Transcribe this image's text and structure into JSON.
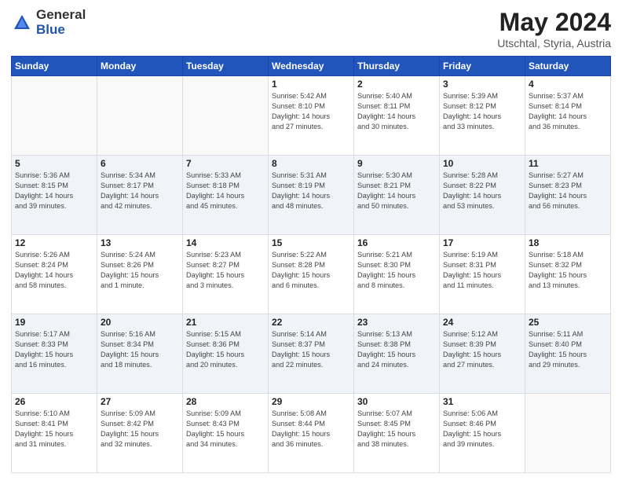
{
  "logo": {
    "general": "General",
    "blue": "Blue"
  },
  "title": {
    "month_year": "May 2024",
    "location": "Utschtal, Styria, Austria"
  },
  "weekdays": [
    "Sunday",
    "Monday",
    "Tuesday",
    "Wednesday",
    "Thursday",
    "Friday",
    "Saturday"
  ],
  "weeks": [
    [
      {
        "day": "",
        "info": ""
      },
      {
        "day": "",
        "info": ""
      },
      {
        "day": "",
        "info": ""
      },
      {
        "day": "1",
        "info": "Sunrise: 5:42 AM\nSunset: 8:10 PM\nDaylight: 14 hours\nand 27 minutes."
      },
      {
        "day": "2",
        "info": "Sunrise: 5:40 AM\nSunset: 8:11 PM\nDaylight: 14 hours\nand 30 minutes."
      },
      {
        "day": "3",
        "info": "Sunrise: 5:39 AM\nSunset: 8:12 PM\nDaylight: 14 hours\nand 33 minutes."
      },
      {
        "day": "4",
        "info": "Sunrise: 5:37 AM\nSunset: 8:14 PM\nDaylight: 14 hours\nand 36 minutes."
      }
    ],
    [
      {
        "day": "5",
        "info": "Sunrise: 5:36 AM\nSunset: 8:15 PM\nDaylight: 14 hours\nand 39 minutes."
      },
      {
        "day": "6",
        "info": "Sunrise: 5:34 AM\nSunset: 8:17 PM\nDaylight: 14 hours\nand 42 minutes."
      },
      {
        "day": "7",
        "info": "Sunrise: 5:33 AM\nSunset: 8:18 PM\nDaylight: 14 hours\nand 45 minutes."
      },
      {
        "day": "8",
        "info": "Sunrise: 5:31 AM\nSunset: 8:19 PM\nDaylight: 14 hours\nand 48 minutes."
      },
      {
        "day": "9",
        "info": "Sunrise: 5:30 AM\nSunset: 8:21 PM\nDaylight: 14 hours\nand 50 minutes."
      },
      {
        "day": "10",
        "info": "Sunrise: 5:28 AM\nSunset: 8:22 PM\nDaylight: 14 hours\nand 53 minutes."
      },
      {
        "day": "11",
        "info": "Sunrise: 5:27 AM\nSunset: 8:23 PM\nDaylight: 14 hours\nand 56 minutes."
      }
    ],
    [
      {
        "day": "12",
        "info": "Sunrise: 5:26 AM\nSunset: 8:24 PM\nDaylight: 14 hours\nand 58 minutes."
      },
      {
        "day": "13",
        "info": "Sunrise: 5:24 AM\nSunset: 8:26 PM\nDaylight: 15 hours\nand 1 minute."
      },
      {
        "day": "14",
        "info": "Sunrise: 5:23 AM\nSunset: 8:27 PM\nDaylight: 15 hours\nand 3 minutes."
      },
      {
        "day": "15",
        "info": "Sunrise: 5:22 AM\nSunset: 8:28 PM\nDaylight: 15 hours\nand 6 minutes."
      },
      {
        "day": "16",
        "info": "Sunrise: 5:21 AM\nSunset: 8:30 PM\nDaylight: 15 hours\nand 8 minutes."
      },
      {
        "day": "17",
        "info": "Sunrise: 5:19 AM\nSunset: 8:31 PM\nDaylight: 15 hours\nand 11 minutes."
      },
      {
        "day": "18",
        "info": "Sunrise: 5:18 AM\nSunset: 8:32 PM\nDaylight: 15 hours\nand 13 minutes."
      }
    ],
    [
      {
        "day": "19",
        "info": "Sunrise: 5:17 AM\nSunset: 8:33 PM\nDaylight: 15 hours\nand 16 minutes."
      },
      {
        "day": "20",
        "info": "Sunrise: 5:16 AM\nSunset: 8:34 PM\nDaylight: 15 hours\nand 18 minutes."
      },
      {
        "day": "21",
        "info": "Sunrise: 5:15 AM\nSunset: 8:36 PM\nDaylight: 15 hours\nand 20 minutes."
      },
      {
        "day": "22",
        "info": "Sunrise: 5:14 AM\nSunset: 8:37 PM\nDaylight: 15 hours\nand 22 minutes."
      },
      {
        "day": "23",
        "info": "Sunrise: 5:13 AM\nSunset: 8:38 PM\nDaylight: 15 hours\nand 24 minutes."
      },
      {
        "day": "24",
        "info": "Sunrise: 5:12 AM\nSunset: 8:39 PM\nDaylight: 15 hours\nand 27 minutes."
      },
      {
        "day": "25",
        "info": "Sunrise: 5:11 AM\nSunset: 8:40 PM\nDaylight: 15 hours\nand 29 minutes."
      }
    ],
    [
      {
        "day": "26",
        "info": "Sunrise: 5:10 AM\nSunset: 8:41 PM\nDaylight: 15 hours\nand 31 minutes."
      },
      {
        "day": "27",
        "info": "Sunrise: 5:09 AM\nSunset: 8:42 PM\nDaylight: 15 hours\nand 32 minutes."
      },
      {
        "day": "28",
        "info": "Sunrise: 5:09 AM\nSunset: 8:43 PM\nDaylight: 15 hours\nand 34 minutes."
      },
      {
        "day": "29",
        "info": "Sunrise: 5:08 AM\nSunset: 8:44 PM\nDaylight: 15 hours\nand 36 minutes."
      },
      {
        "day": "30",
        "info": "Sunrise: 5:07 AM\nSunset: 8:45 PM\nDaylight: 15 hours\nand 38 minutes."
      },
      {
        "day": "31",
        "info": "Sunrise: 5:06 AM\nSunset: 8:46 PM\nDaylight: 15 hours\nand 39 minutes."
      },
      {
        "day": "",
        "info": ""
      }
    ]
  ]
}
